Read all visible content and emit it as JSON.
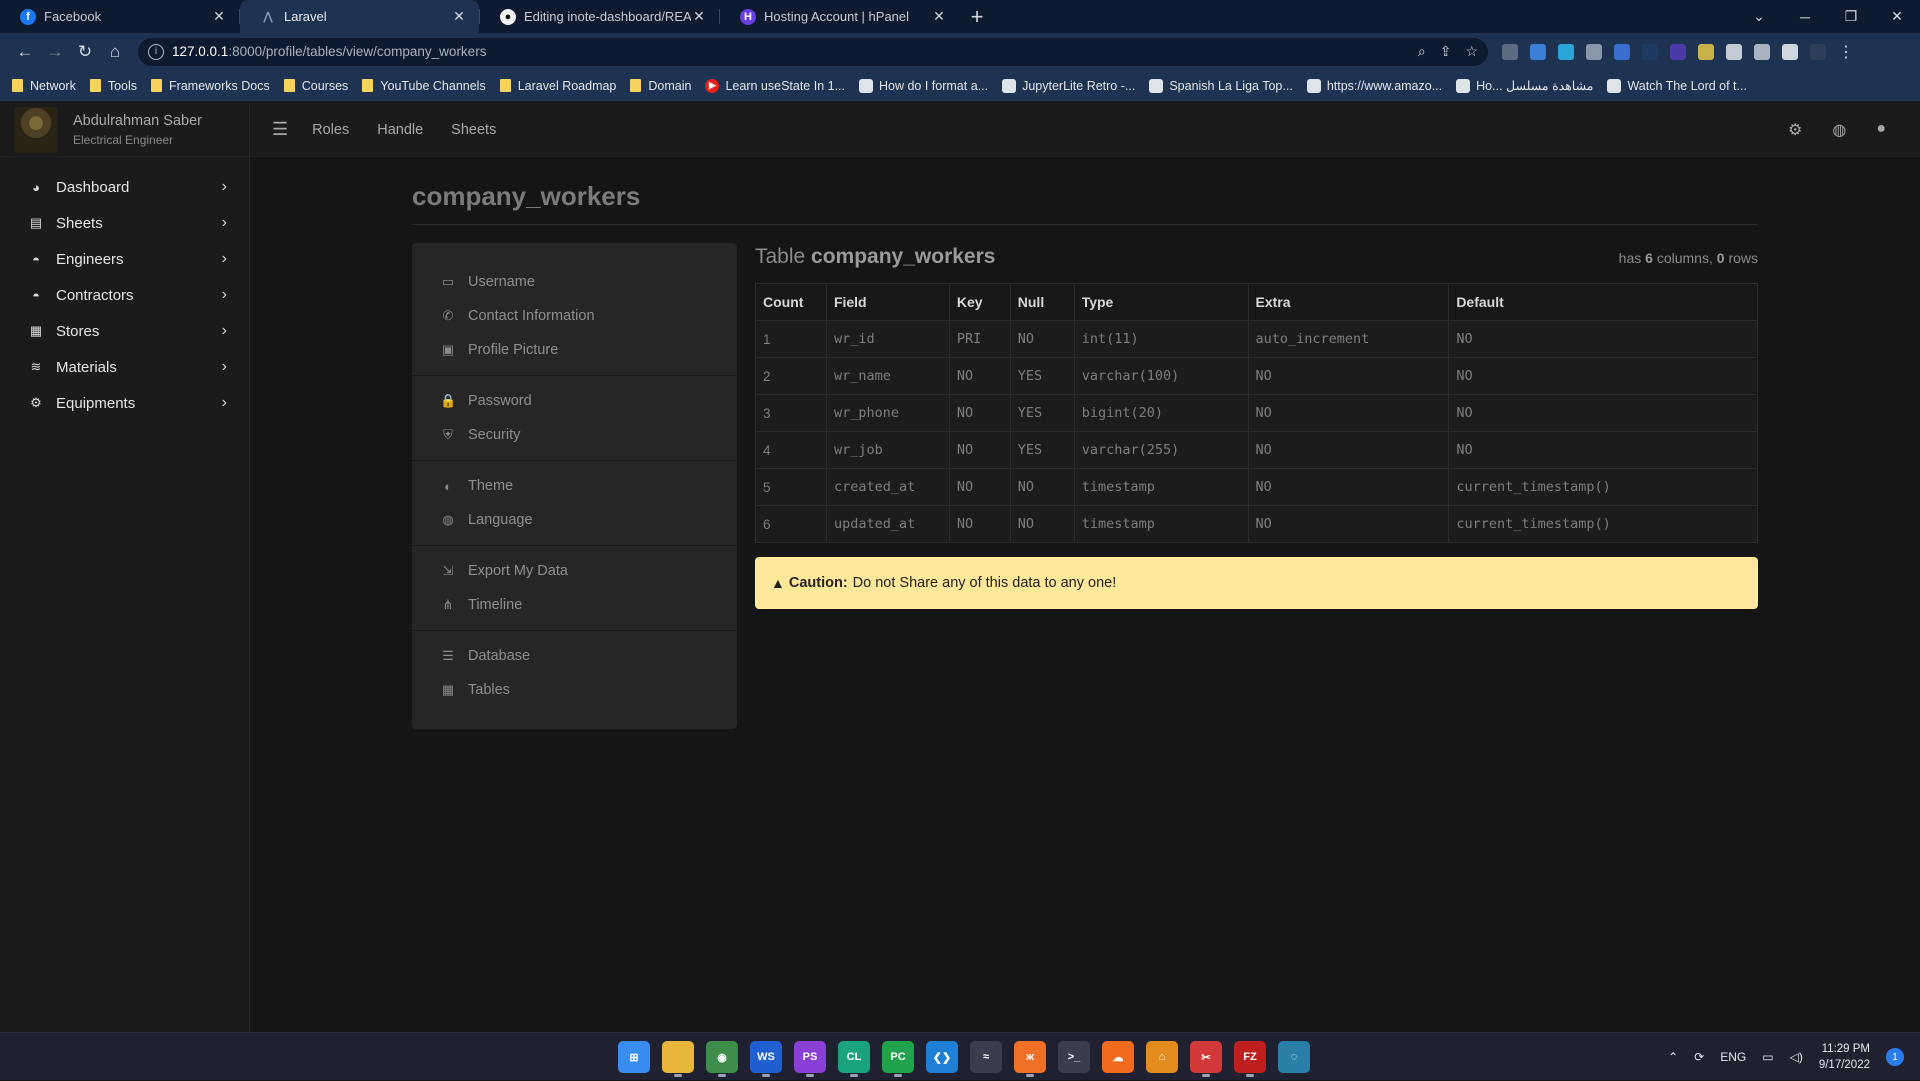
{
  "browser": {
    "tabs": [
      {
        "title": "Facebook",
        "icon": "facebook-icon",
        "active": false
      },
      {
        "title": "Laravel",
        "icon": "laravel-icon",
        "active": true
      },
      {
        "title": "Editing inote-dashboard/README",
        "icon": "github-icon",
        "active": false
      },
      {
        "title": "Hosting Account | hPanel",
        "icon": "hostinger-icon",
        "active": false
      }
    ],
    "url_host": "127.0.0.1",
    "url_rest": ":8000/profile/tables/view/company_workers",
    "bookmarks": [
      {
        "label": "Network",
        "type": "folder"
      },
      {
        "label": "Tools",
        "type": "folder"
      },
      {
        "label": "Frameworks Docs",
        "type": "folder"
      },
      {
        "label": "Courses",
        "type": "folder"
      },
      {
        "label": "YouTube Channels",
        "type": "folder"
      },
      {
        "label": "Laravel Roadmap",
        "type": "folder"
      },
      {
        "label": "Domain",
        "type": "folder"
      },
      {
        "label": "Learn useState In 1...",
        "type": "youtube"
      },
      {
        "label": "How do I format a...",
        "type": "page"
      },
      {
        "label": "JupyterLite Retro -...",
        "type": "page"
      },
      {
        "label": "Spanish La Liga Top...",
        "type": "page"
      },
      {
        "label": "https://www.amazo...",
        "type": "page"
      },
      {
        "label": "Ho... مشاهدة مسلسل",
        "type": "page"
      },
      {
        "label": "Watch The Lord of t...",
        "type": "page"
      }
    ]
  },
  "user": {
    "name": "Abdulrahman Saber",
    "role": "Electrical Engineer"
  },
  "sidebar": {
    "items": [
      {
        "label": "Dashboard",
        "icon": "gauge-icon",
        "glyph": "◕"
      },
      {
        "label": "Sheets",
        "icon": "file-icon",
        "glyph": "▤"
      },
      {
        "label": "Engineers",
        "icon": "hardhat-icon",
        "glyph": "◓"
      },
      {
        "label": "Contractors",
        "icon": "hardhat-icon",
        "glyph": "◓"
      },
      {
        "label": "Stores",
        "icon": "store-icon",
        "glyph": "▦"
      },
      {
        "label": "Materials",
        "icon": "layers-icon",
        "glyph": "≋"
      },
      {
        "label": "Equipments",
        "icon": "cogs-icon",
        "glyph": "⚙"
      }
    ]
  },
  "topbar": {
    "links": [
      "Roles",
      "Handle",
      "Sheets"
    ]
  },
  "page": {
    "title": "company_workers"
  },
  "settings": {
    "groups": [
      [
        {
          "label": "Username",
          "icon": "id-card-icon",
          "glyph": "▭"
        },
        {
          "label": "Contact Information",
          "icon": "phone-icon",
          "glyph": "✆"
        },
        {
          "label": "Profile Picture",
          "icon": "image-icon",
          "glyph": "▣"
        }
      ],
      [
        {
          "label": "Password",
          "icon": "lock-icon",
          "glyph": "🔒"
        },
        {
          "label": "Security",
          "icon": "shield-icon",
          "glyph": "⛨"
        }
      ],
      [
        {
          "label": "Theme",
          "icon": "palette-icon",
          "glyph": "◐"
        },
        {
          "label": "Language",
          "icon": "globe-icon",
          "glyph": "◍"
        }
      ],
      [
        {
          "label": "Export My Data",
          "icon": "export-file-icon",
          "glyph": "⇲"
        },
        {
          "label": "Timeline",
          "icon": "sitemap-icon",
          "glyph": "⋔"
        }
      ],
      [
        {
          "label": "Database",
          "icon": "database-icon",
          "glyph": "☰"
        },
        {
          "label": "Tables",
          "icon": "table-icon",
          "glyph": "▦"
        }
      ]
    ]
  },
  "table": {
    "heading_prefix": "Table",
    "heading_name": "company_workers",
    "meta": {
      "prefix": "has",
      "columns": "6",
      "mid": "columns,",
      "rows": "0",
      "suffix": "rows"
    },
    "headers": [
      "Count",
      "Field",
      "Key",
      "Null",
      "Type",
      "Extra",
      "Default"
    ],
    "rows": [
      [
        "1",
        "wr_id",
        "PRI",
        "NO",
        "int(11)",
        "auto_increment",
        "NO"
      ],
      [
        "2",
        "wr_name",
        "NO",
        "YES",
        "varchar(100)",
        "NO",
        "NO"
      ],
      [
        "3",
        "wr_phone",
        "NO",
        "YES",
        "bigint(20)",
        "NO",
        "NO"
      ],
      [
        "4",
        "wr_job",
        "NO",
        "YES",
        "varchar(255)",
        "NO",
        "NO"
      ],
      [
        "5",
        "created_at",
        "NO",
        "NO",
        "timestamp",
        "NO",
        "current_timestamp()"
      ],
      [
        "6",
        "updated_at",
        "NO",
        "NO",
        "timestamp",
        "NO",
        "current_timestamp()"
      ]
    ]
  },
  "caution": {
    "label": "Caution:",
    "text": "Do not Share any of this data to any one!"
  },
  "taskbar": {
    "lang": "ENG",
    "time": "11:29 PM",
    "date": "9/17/2022",
    "notifications": "1",
    "apps": [
      {
        "name": "windows-start-icon",
        "color": "#3a8df0",
        "text": "⊞"
      },
      {
        "name": "file-explorer-icon",
        "color": "#e8b63a",
        "text": ""
      },
      {
        "name": "chrome-icon",
        "color": "#3f8d4a",
        "text": "◉"
      },
      {
        "name": "webstorm-icon",
        "color": "#1f5fd1",
        "text": "WS"
      },
      {
        "name": "phpstorm-icon",
        "color": "#8a3fd6",
        "text": "PS"
      },
      {
        "name": "clion-icon",
        "color": "#1aa37f",
        "text": "CL"
      },
      {
        "name": "pycharm-icon",
        "color": "#21a34e",
        "text": "PC"
      },
      {
        "name": "vscode-icon",
        "color": "#1e7fd6",
        "text": "❮❯"
      },
      {
        "name": "tool-icon",
        "color": "#3a3d4e",
        "text": "≈"
      },
      {
        "name": "xampp-icon",
        "color": "#f06f27",
        "text": "ж"
      },
      {
        "name": "terminal-icon",
        "color": "#3a3d4e",
        "text": ">_"
      },
      {
        "name": "soundcloud-icon",
        "color": "#f26b1d",
        "text": "☁"
      },
      {
        "name": "git-icon",
        "color": "#e48b1e",
        "text": "⌂"
      },
      {
        "name": "snipping-icon",
        "color": "#d23a3a",
        "text": "✂"
      },
      {
        "name": "filezilla-icon",
        "color": "#bf1f1f",
        "text": "FZ"
      },
      {
        "name": "app-icon",
        "color": "#2a7fa8",
        "text": "◌"
      }
    ]
  }
}
